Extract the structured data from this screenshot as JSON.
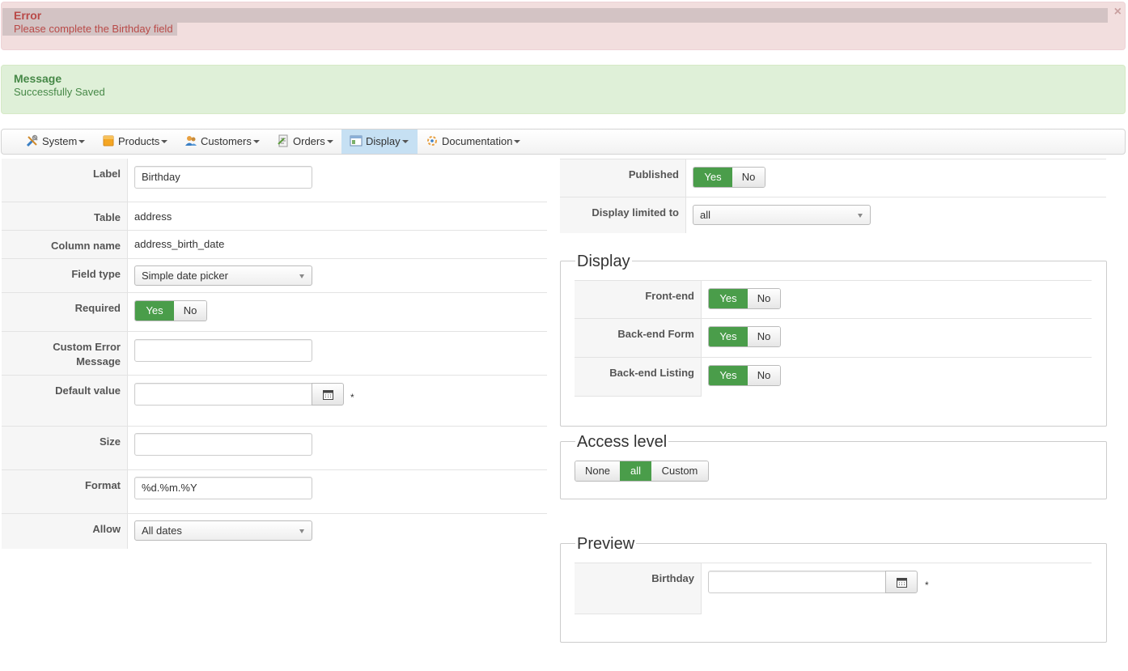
{
  "alerts": {
    "error": {
      "title": "Error",
      "text": "Please complete the Birthday field",
      "close": "×"
    },
    "success": {
      "title": "Message",
      "text": "Successfully Saved"
    }
  },
  "nav": [
    {
      "label": "System",
      "icon": "tools-icon"
    },
    {
      "label": "Products",
      "icon": "box-icon"
    },
    {
      "label": "Customers",
      "icon": "users-icon"
    },
    {
      "label": "Orders",
      "icon": "orders-icon"
    },
    {
      "label": "Display",
      "icon": "display-icon",
      "active": true
    },
    {
      "label": "Documentation",
      "icon": "documentation-icon"
    }
  ],
  "form": {
    "label": {
      "key": "Label",
      "value": "Birthday"
    },
    "table": {
      "key": "Table",
      "value": "address"
    },
    "column": {
      "key": "Column name",
      "value": "address_birth_date"
    },
    "field_type": {
      "key": "Field type",
      "value": "Simple date picker"
    },
    "required": {
      "key": "Required",
      "yes": "Yes",
      "no": "No",
      "selected": "Yes"
    },
    "custom_error": {
      "key_line1": "Custom Error",
      "key_line2": "Message",
      "value": ""
    },
    "default_value": {
      "key": "Default value",
      "value": "",
      "star": "*"
    },
    "size": {
      "key": "Size",
      "value": ""
    },
    "format": {
      "key": "Format",
      "value": "%d.%m.%Y"
    },
    "allow": {
      "key": "Allow",
      "value": "All dates"
    }
  },
  "right": {
    "published": {
      "key": "Published",
      "yes": "Yes",
      "no": "No",
      "selected": "Yes"
    },
    "display_limited": {
      "key": "Display limited to",
      "value": "all"
    },
    "display": {
      "legend": "Display",
      "frontend": {
        "key": "Front-end",
        "yes": "Yes",
        "no": "No",
        "selected": "Yes"
      },
      "backend_form": {
        "key": "Back-end Form",
        "yes": "Yes",
        "no": "No",
        "selected": "Yes"
      },
      "backend_listing": {
        "key": "Back-end Listing",
        "yes": "Yes",
        "no": "No",
        "selected": "Yes"
      }
    },
    "access": {
      "legend": "Access level",
      "none": "None",
      "all": "all",
      "custom": "Custom",
      "selected": "all"
    },
    "preview": {
      "legend": "Preview",
      "key": "Birthday",
      "value": "",
      "star": "*"
    }
  },
  "colors": {
    "success_green": "#4a9d4a",
    "error_text": "#b94a48",
    "success_text": "#468847",
    "active_tab": "#c6e0f3"
  }
}
